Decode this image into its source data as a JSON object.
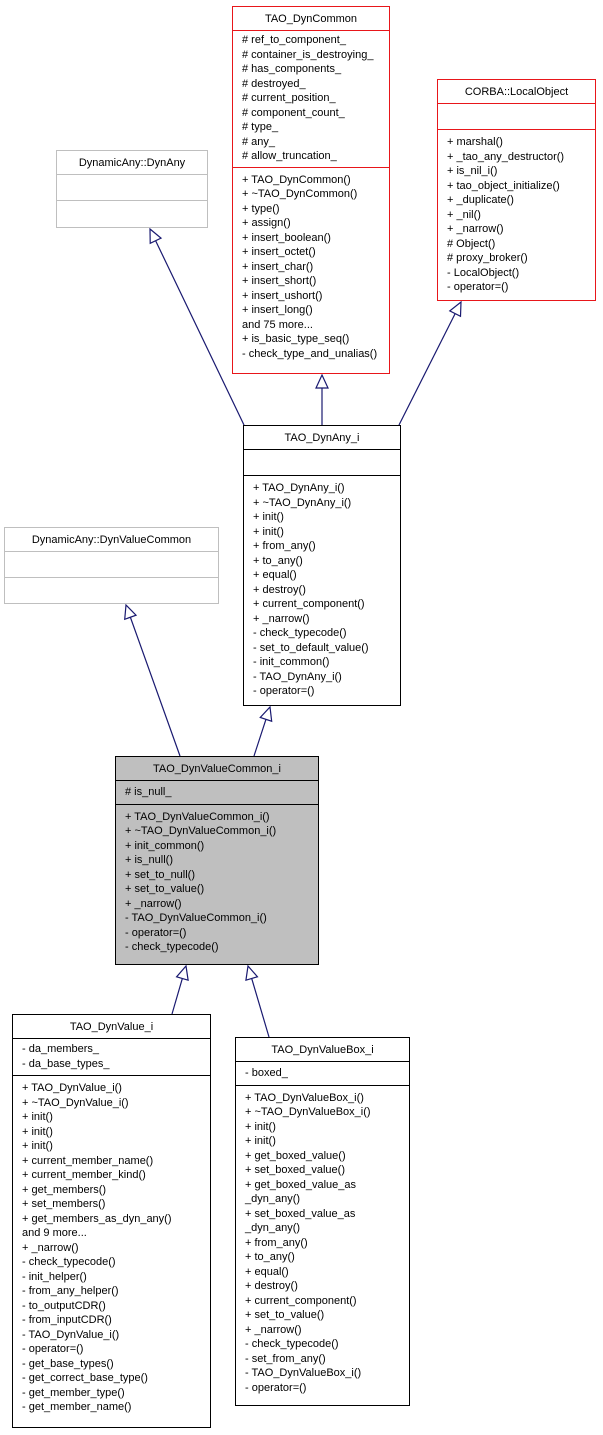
{
  "diagram": {
    "type": "class-inheritance",
    "classes": {
      "dyncommon": {
        "name": "TAO_DynCommon",
        "attributes": [
          "# ref_to_component_",
          "# container_is_destroying_",
          "# has_components_",
          "# destroyed_",
          "# current_position_",
          "# component_count_",
          "# type_",
          "# any_",
          "# allow_truncation_"
        ],
        "operations": [
          "+ TAO_DynCommon()",
          "+ ~TAO_DynCommon()",
          "+ type()",
          "+ assign()",
          "+ insert_boolean()",
          "+ insert_octet()",
          "+ insert_char()",
          "+ insert_short()",
          "+ insert_ushort()",
          "+ insert_long()",
          "and 75 more...",
          "+ is_basic_type_seq()",
          "- check_type_and_unalias()"
        ]
      },
      "localobject": {
        "name": "CORBA::LocalObject",
        "attributes": [],
        "operations": [
          "+ marshal()",
          "+ _tao_any_destructor()",
          "+ is_nil_i()",
          "+ tao_object_initialize()",
          "+ _duplicate()",
          "+ _nil()",
          "+ _narrow()",
          "# Object()",
          "# proxy_broker()",
          "- LocalObject()",
          "- operator=()"
        ]
      },
      "dynany": {
        "name": "DynamicAny::DynAny",
        "attributes": [],
        "operations": []
      },
      "dynany_i": {
        "name": "TAO_DynAny_i",
        "attributes": [],
        "operations": [
          "+ TAO_DynAny_i()",
          "+ ~TAO_DynAny_i()",
          "+ init()",
          "+ init()",
          "+ from_any()",
          "+ to_any()",
          "+ equal()",
          "+ destroy()",
          "+ current_component()",
          "+ _narrow()",
          "- check_typecode()",
          "- set_to_default_value()",
          "- init_common()",
          "- TAO_DynAny_i()",
          "- operator=()"
        ]
      },
      "dynvaluecommon": {
        "name": "DynamicAny::DynValueCommon",
        "attributes": [],
        "operations": []
      },
      "dynvaluecommon_i": {
        "name": "TAO_DynValueCommon_i",
        "attributes": [
          "# is_null_"
        ],
        "operations": [
          "+ TAO_DynValueCommon_i()",
          "+ ~TAO_DynValueCommon_i()",
          "+ init_common()",
          "+ is_null()",
          "+ set_to_null()",
          "+ set_to_value()",
          "+ _narrow()",
          "- TAO_DynValueCommon_i()",
          "- operator=()",
          "- check_typecode()"
        ]
      },
      "dynvalue_i": {
        "name": "TAO_DynValue_i",
        "attributes": [
          "- da_members_",
          "- da_base_types_"
        ],
        "operations": [
          "+ TAO_DynValue_i()",
          "+ ~TAO_DynValue_i()",
          "+ init()",
          "+ init()",
          "+ init()",
          "+ current_member_name()",
          "+ current_member_kind()",
          "+ get_members()",
          "+ set_members()",
          "+ get_members_as_dyn_any()",
          "and 9 more...",
          "+ _narrow()",
          "- check_typecode()",
          "- init_helper()",
          "- from_any_helper()",
          "- to_outputCDR()",
          "- from_inputCDR()",
          "- TAO_DynValue_i()",
          "- operator=()",
          "- get_base_types()",
          "- get_correct_base_type()",
          "- get_member_type()",
          "- get_member_name()"
        ]
      },
      "dynvaluebox_i": {
        "name": "TAO_DynValueBox_i",
        "attributes": [
          "- boxed_"
        ],
        "operations": [
          "+ TAO_DynValueBox_i()",
          "+ ~TAO_DynValueBox_i()",
          "+ init()",
          "+ init()",
          "+ get_boxed_value()",
          "+ set_boxed_value()",
          "+ get_boxed_value_as",
          "_dyn_any()",
          "+ set_boxed_value_as",
          "_dyn_any()",
          "+ from_any()",
          "+ to_any()",
          "+ equal()",
          "+ destroy()",
          "+ current_component()",
          "+ set_to_value()",
          "+ _narrow()",
          "- check_typecode()",
          "- set_from_any()",
          "- TAO_DynValueBox_i()",
          "- operator=()"
        ]
      }
    },
    "inheritance": [
      {
        "from": "dynany_i",
        "to": "dynany"
      },
      {
        "from": "dynany_i",
        "to": "dyncommon"
      },
      {
        "from": "dynany_i",
        "to": "localobject"
      },
      {
        "from": "dynvaluecommon_i",
        "to": "dynvaluecommon"
      },
      {
        "from": "dynvaluecommon_i",
        "to": "dynany_i"
      },
      {
        "from": "dynvalue_i",
        "to": "dynvaluecommon_i"
      },
      {
        "from": "dynvaluebox_i",
        "to": "dynvaluecommon_i"
      }
    ],
    "colors": {
      "edge": "#191970",
      "documented_border": "#e8161a",
      "external_border": "#bfbfbf",
      "current_fill": "#bfbfbf"
    }
  }
}
